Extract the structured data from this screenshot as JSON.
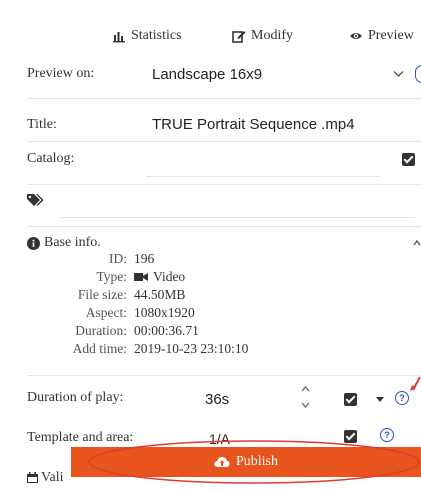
{
  "tabs": {
    "statistics": "Statistics",
    "modify": "Modify",
    "preview": "Preview"
  },
  "form": {
    "preview_on_label": "Preview on:",
    "preview_on_value": "Landscape 16x9",
    "title_label": "Title:",
    "title_value": "TRUE Portrait Sequence .mp4",
    "catalog_label": "Catalog:",
    "catalog_value": ""
  },
  "info": {
    "header": "Base info.",
    "rows": [
      {
        "key": "ID:",
        "value": "196"
      },
      {
        "key": "Type:",
        "value": "Video"
      },
      {
        "key": "File size:",
        "value": "44.50MB"
      },
      {
        "key": "Aspect:",
        "value": "1080x1920"
      },
      {
        "key": "Duration:",
        "value": "00:00:36.71"
      },
      {
        "key": "Add time:",
        "value": "2019-10-23 23:10:10"
      }
    ]
  },
  "play": {
    "duration_label": "Duration of play:",
    "duration_value": "36s",
    "template_label": "Template and area:",
    "template_value": "1/A"
  },
  "footer": {
    "publish_label": "Publish",
    "partial_label": "Vali"
  },
  "colors": {
    "accent": "#e8541e",
    "help": "#2b53c8",
    "annotation": "#e03a32"
  },
  "icons": [
    "chart-icon",
    "edit-icon",
    "eye-icon",
    "chevron-down-icon",
    "tag-icon",
    "info-icon",
    "video-icon",
    "check-icon",
    "caret-down-icon",
    "help-icon",
    "cloud-upload-icon",
    "calendar-icon"
  ]
}
